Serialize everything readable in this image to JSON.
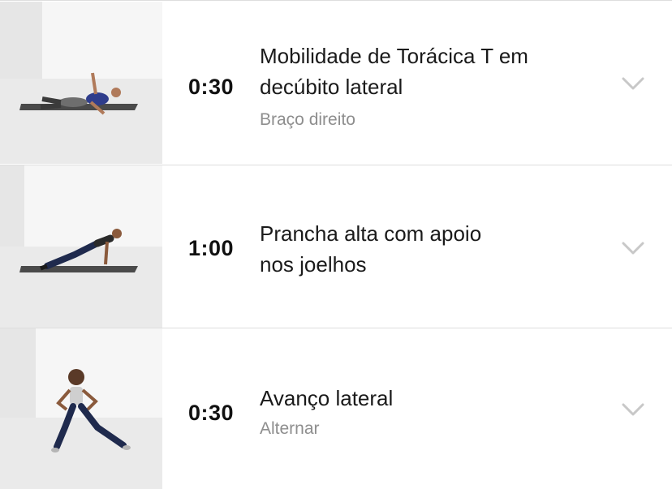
{
  "exercises": [
    {
      "time": "0:30",
      "title_line1": "Mobilidade de Torácica T em",
      "title_line2": "decúbito lateral",
      "subtitle": "Braço direito",
      "thumbnail_icon": "side-lying-thoracic-rotation-photo"
    },
    {
      "time": "1:00",
      "title_line1": "Prancha alta com apoio",
      "title_line2": "nos joelhos",
      "subtitle": "",
      "thumbnail_icon": "kneeling-high-plank-photo"
    },
    {
      "time": "0:30",
      "title_line1": "Avanço lateral",
      "title_line2": "",
      "subtitle": "Alternar",
      "thumbnail_icon": "lateral-lunge-photo"
    }
  ],
  "chevron_icon": "chevron-down-icon",
  "colors": {
    "text_primary": "#1a1a1a",
    "text_secondary": "#8e8e8e",
    "chevron": "#c8c8c8",
    "divider": "#dedede",
    "thumb_background": "#ececec"
  }
}
